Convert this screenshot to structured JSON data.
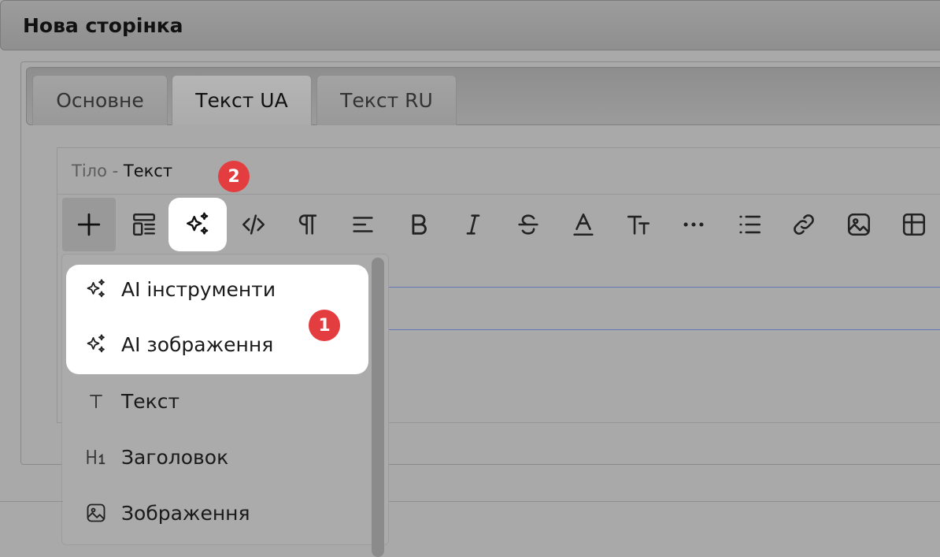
{
  "page": {
    "title": "Нова сторінка"
  },
  "tabs": [
    {
      "label": "Основне",
      "active": false
    },
    {
      "label": "Текст UA",
      "active": true
    },
    {
      "label": "Текст RU",
      "active": false
    }
  ],
  "editor": {
    "label_prefix": "Тіло",
    "label_sep": " - ",
    "label_main": "Текст",
    "toolbar": [
      {
        "name": "plus-icon"
      },
      {
        "name": "blocks-icon"
      },
      {
        "name": "sparkles-icon"
      },
      {
        "name": "code-icon"
      },
      {
        "name": "paragraph-icon"
      },
      {
        "name": "align-left-icon"
      },
      {
        "name": "bold-icon"
      },
      {
        "name": "italic-icon"
      },
      {
        "name": "strikethrough-icon"
      },
      {
        "name": "font-color-icon"
      },
      {
        "name": "font-size-icon"
      },
      {
        "name": "more-icon"
      },
      {
        "name": "list-icon"
      },
      {
        "name": "link-icon"
      },
      {
        "name": "image-icon"
      },
      {
        "name": "table-icon"
      }
    ]
  },
  "menu": {
    "items": [
      {
        "label": "AI інструменти",
        "icon": "sparkles-icon"
      },
      {
        "label": "AI зображення",
        "icon": "sparkles-icon"
      },
      {
        "label": "Текст",
        "icon": "text-icon"
      },
      {
        "label": "Заголовок",
        "icon": "heading-icon"
      },
      {
        "label": "Зображення",
        "icon": "image-icon"
      }
    ]
  },
  "badges": {
    "one": "1",
    "two": "2"
  },
  "colors": {
    "badge": "#e43d3f",
    "highlight": "#ffffff",
    "line_accent": "#6276b8"
  }
}
